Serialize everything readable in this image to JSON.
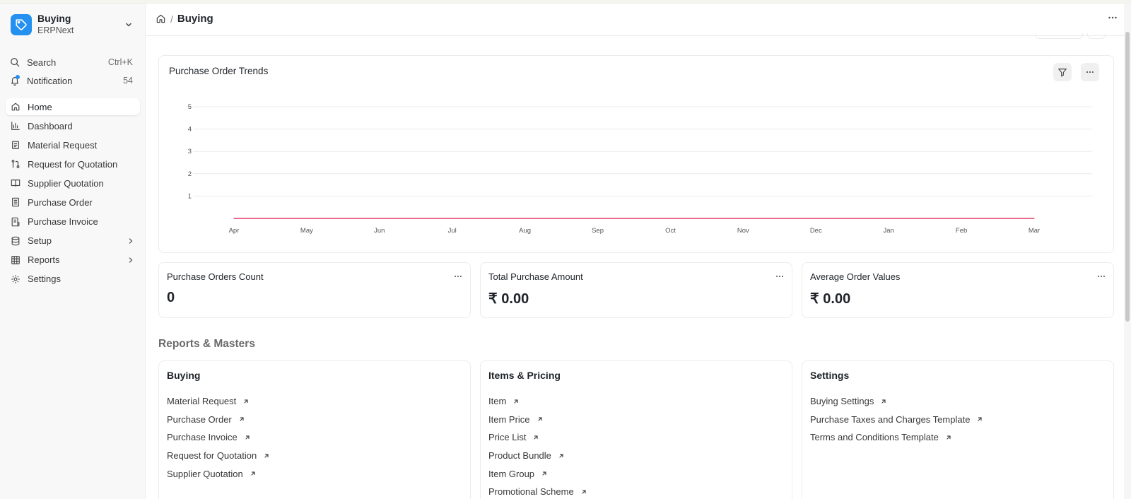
{
  "app": {
    "name": "Buying",
    "subtitle": "ERPNext"
  },
  "utilities": {
    "search_label": "Search",
    "search_shortcut": "Ctrl+K",
    "notification_label": "Notification",
    "notification_count": "54"
  },
  "sidebar": {
    "items": [
      {
        "label": "Home",
        "icon": "home-icon",
        "active": true
      },
      {
        "label": "Dashboard",
        "icon": "chart-icon"
      },
      {
        "label": "Material Request",
        "icon": "clipboard-icon"
      },
      {
        "label": "Request for Quotation",
        "icon": "git-compare-icon"
      },
      {
        "label": "Supplier Quotation",
        "icon": "book-open-icon"
      },
      {
        "label": "Purchase Order",
        "icon": "file-text-icon"
      },
      {
        "label": "Purchase Invoice",
        "icon": "receipt-icon"
      },
      {
        "label": "Setup",
        "icon": "database-icon",
        "expandable": true
      },
      {
        "label": "Reports",
        "icon": "table-icon",
        "expandable": true
      },
      {
        "label": "Settings",
        "icon": "gear-icon"
      }
    ]
  },
  "breadcrumb": {
    "separator": "/",
    "current": "Buying"
  },
  "chart_card": {
    "title": "Purchase Order Trends"
  },
  "chart_data": {
    "type": "line",
    "title": "Purchase Order Trends",
    "xlabel": "",
    "ylabel": "",
    "categories": [
      "Apr",
      "May",
      "Jun",
      "Jul",
      "Aug",
      "Sep",
      "Oct",
      "Nov",
      "Dec",
      "Jan",
      "Feb",
      "Mar"
    ],
    "series": [
      {
        "values": [
          0,
          0,
          0,
          0,
          0,
          0,
          0,
          0,
          0,
          0,
          0,
          0
        ],
        "color": "#ec6a8c"
      }
    ],
    "yticks": [
      1,
      2,
      3,
      4,
      5
    ],
    "ylim": [
      0,
      5
    ],
    "grid": true
  },
  "number_cards": [
    {
      "title": "Purchase Orders Count",
      "value": "0"
    },
    {
      "title": "Total Purchase Amount",
      "value": "₹ 0.00"
    },
    {
      "title": "Average Order Values",
      "value": "₹ 0.00"
    }
  ],
  "reports_section": {
    "title": "Reports & Masters"
  },
  "link_cards": [
    {
      "title": "Buying",
      "links": [
        "Material Request",
        "Purchase Order",
        "Purchase Invoice",
        "Request for Quotation",
        "Supplier Quotation"
      ]
    },
    {
      "title": "Items & Pricing",
      "links": [
        "Item",
        "Item Price",
        "Price List",
        "Product Bundle",
        "Item Group",
        "Promotional Scheme"
      ]
    },
    {
      "title": "Settings",
      "links": [
        "Buying Settings",
        "Purchase Taxes and Charges Template",
        "Terms and Conditions Template"
      ]
    }
  ],
  "colors": {
    "accent": "#2490ef",
    "line": "#ec6a8c",
    "grid": "#ececec"
  }
}
